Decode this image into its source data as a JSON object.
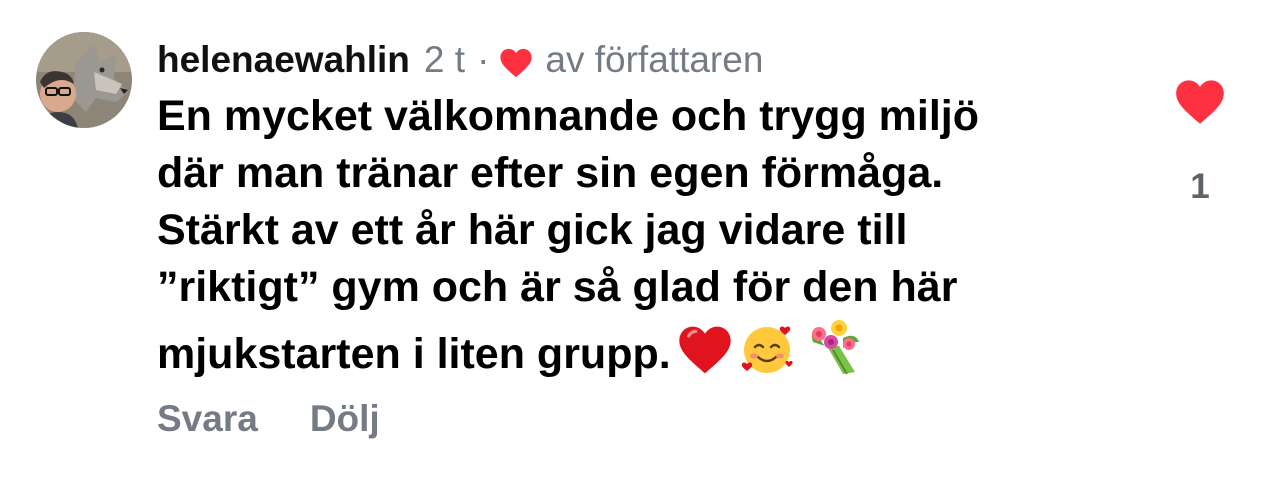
{
  "comment": {
    "username": "helenaewahlin",
    "timestamp": "2 t",
    "separator": "·",
    "liked_by_author_text": "av författaren",
    "text_lines": [
      "En mycket välkomnande och trygg miljö",
      "där man tränar efter sin egen förmåga.",
      "Stärkt av ett år här gick jag vidare till",
      "”riktigt” gym och är så glad för den här",
      "mjukstarten i liten grupp."
    ],
    "emojis": [
      "red-heart",
      "smiling-face-with-hearts",
      "bouquet"
    ],
    "actions": {
      "reply_label": "Svara",
      "hide_label": "Dölj"
    },
    "like_count": "1",
    "colors": {
      "heart_red": "#ff3040",
      "meta_gray": "#757b84"
    }
  }
}
